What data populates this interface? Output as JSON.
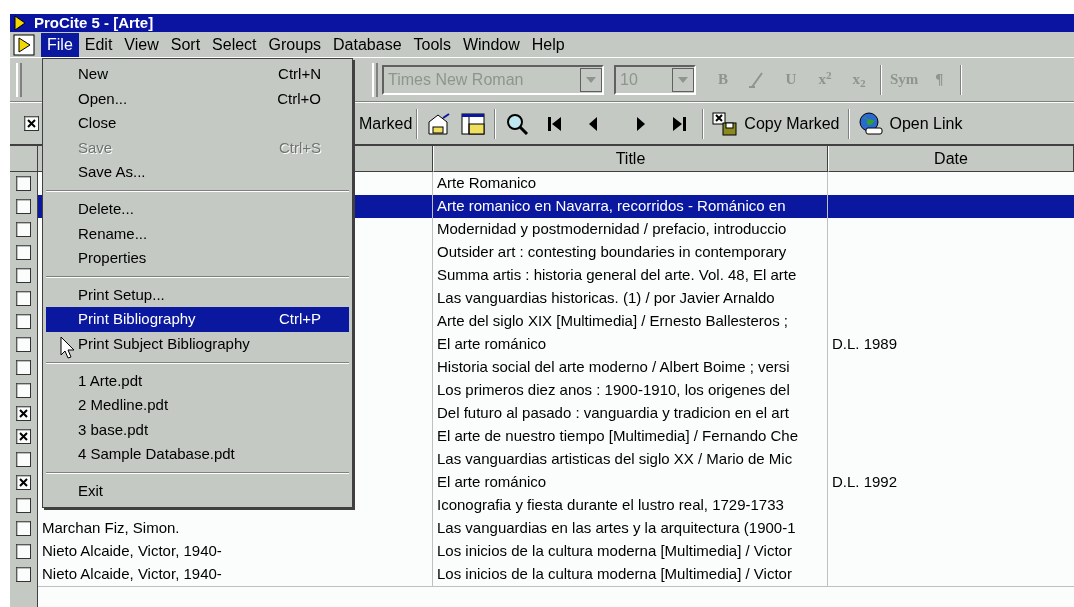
{
  "window": {
    "title": "ProCite 5 - [Arte]"
  },
  "menu_bar": [
    {
      "label": "File",
      "selected": true
    },
    {
      "label": "Edit",
      "selected": false
    },
    {
      "label": "View",
      "selected": false
    },
    {
      "label": "Sort",
      "selected": false
    },
    {
      "label": "Select",
      "selected": false
    },
    {
      "label": "Groups",
      "selected": false
    },
    {
      "label": "Database",
      "selected": false
    },
    {
      "label": "Tools",
      "selected": false
    },
    {
      "label": "Window",
      "selected": false
    },
    {
      "label": "Help",
      "selected": false
    }
  ],
  "format_toolbar": {
    "font": {
      "value": "Times New Roman",
      "disabled": true
    },
    "size": {
      "value": "10",
      "disabled": true
    },
    "buttons": [
      {
        "kind": "text",
        "label": "B",
        "disabled": true
      },
      {
        "kind": "italic",
        "disabled": true
      },
      {
        "kind": "text",
        "label": "U",
        "disabled": true
      },
      {
        "kind": "text",
        "label": "x$^{2}$",
        "disabled": true
      },
      {
        "kind": "text",
        "label": "x$_{2}$",
        "disabled": true
      },
      {
        "kind": "separator"
      },
      {
        "kind": "text",
        "label": "Sym",
        "disabled": true
      },
      {
        "kind": "text",
        "label": "¶",
        "disabled": true
      }
    ]
  },
  "record_toolbar": {
    "marked_checked": true,
    "marked_label": "Marked",
    "copy_marked": "Copy Marked",
    "open_link": "Open Link"
  },
  "file_menu": [
    {
      "kind": "item",
      "label": "New",
      "shortcut": "Ctrl+N",
      "disabled": false,
      "selected": false
    },
    {
      "kind": "item",
      "label": "Open...",
      "shortcut": "Ctrl+O",
      "disabled": false,
      "selected": false
    },
    {
      "kind": "item",
      "label": "Close",
      "disabled": false,
      "selected": false
    },
    {
      "kind": "item",
      "label": "Save",
      "shortcut": "Ctrl+S",
      "disabled": true,
      "selected": false
    },
    {
      "kind": "item",
      "label": "Save As...",
      "disabled": false,
      "selected": false
    },
    {
      "kind": "separator"
    },
    {
      "kind": "item",
      "label": "Delete...",
      "disabled": false,
      "selected": false
    },
    {
      "kind": "item",
      "label": "Rename...",
      "disabled": false,
      "selected": false
    },
    {
      "kind": "item",
      "label": "Properties",
      "disabled": false,
      "selected": false
    },
    {
      "kind": "separator"
    },
    {
      "kind": "item",
      "label": "Print Setup...",
      "disabled": false,
      "selected": false
    },
    {
      "kind": "item",
      "label": "Print Bibliography",
      "shortcut": "Ctrl+P",
      "disabled": false,
      "selected": true
    },
    {
      "kind": "item",
      "label": "Print Subject Bibliography",
      "disabled": false,
      "selected": false
    },
    {
      "kind": "separator"
    },
    {
      "kind": "item",
      "label": "1 Arte.pdt",
      "disabled": false,
      "selected": false
    },
    {
      "kind": "item",
      "label": "2 Medline.pdt",
      "disabled": false,
      "selected": false
    },
    {
      "kind": "item",
      "label": "3 base.pdt",
      "disabled": false,
      "selected": false
    },
    {
      "kind": "item",
      "label": "4 Sample Database.pdt",
      "disabled": false,
      "selected": false
    },
    {
      "kind": "separator"
    },
    {
      "kind": "item",
      "label": "Exit",
      "disabled": false,
      "selected": false
    }
  ],
  "table": {
    "columns": [
      {
        "label": "Title"
      },
      {
        "label": "Date"
      }
    ],
    "rows": [
      {
        "marked": false,
        "selected": false,
        "title": "Arte Romanico"
      },
      {
        "marked": false,
        "selected": true,
        "title": "Arte romanico en Navarra, recorridos - Románico en"
      },
      {
        "marked": false,
        "selected": false,
        "title": "Modernidad y postmodernidad / prefacio, introduccio"
      },
      {
        "marked": false,
        "selected": false,
        "title": "Outsider art : contesting boundaries in contemporary"
      },
      {
        "marked": false,
        "selected": false,
        "title": "Summa artis : historia general del arte. Vol. 48, El arte"
      },
      {
        "marked": false,
        "selected": false,
        "title": "Las vanguardias historicas. (1) / por Javier Arnaldo"
      },
      {
        "marked": false,
        "selected": false,
        "title": "Arte del siglo XIX [Multimedia] / Ernesto Ballesteros ;"
      },
      {
        "marked": false,
        "selected": false,
        "title": "El arte románico",
        "date": "D.L. 1989"
      },
      {
        "marked": false,
        "selected": false,
        "title": "Historia social del arte moderno / Albert Boime ; versi"
      },
      {
        "marked": false,
        "selected": false,
        "title": "Los primeros diez anos : 1900-1910, los origenes del"
      },
      {
        "marked": true,
        "selected": false,
        "title": "Del futuro al pasado : vanguardia y tradicion en el art"
      },
      {
        "marked": true,
        "selected": false,
        "title": "El arte de nuestro tiempo [Multimedia] / Fernando Che"
      },
      {
        "marked": false,
        "selected": false,
        "title": "Las vanguardias artisticas del siglo XX / Mario de Mic"
      },
      {
        "marked": true,
        "selected": false,
        "title": "El arte románico",
        "date": "D.L. 1992"
      },
      {
        "marked": false,
        "selected": false,
        "title": "Iconografia y fiesta durante el lustro real, 1729-1733"
      },
      {
        "marked": false,
        "selected": false,
        "author": "Marchan Fiz, Simon.",
        "title": "Las vanguardias en las artes y la arquitectura (1900-1"
      },
      {
        "marked": false,
        "selected": false,
        "author": "Nieto Alcaide, Victor, 1940-",
        "title": "Los inicios de la cultura moderna [Multimedia] / Victor"
      },
      {
        "marked": false,
        "selected": false,
        "author": "Nieto Alcaide, Victor, 1940-",
        "title": "Los inicios de la cultura moderna [Multimedia] / Victor"
      }
    ]
  }
}
